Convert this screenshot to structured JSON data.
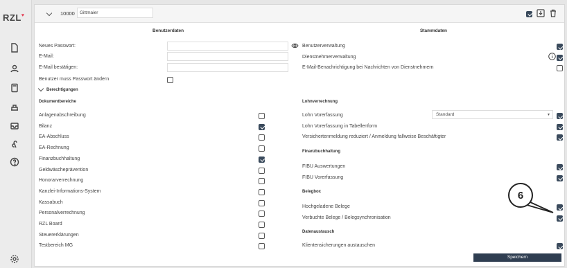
{
  "sidebar": {
    "logo": "RZL",
    "icons": [
      "document-icon",
      "users-icon",
      "calculator-icon",
      "stamp-icon",
      "inbox-icon",
      "clover-icon",
      "help-icon",
      "settings-icon"
    ]
  },
  "topbar": {
    "client_number": "10000",
    "client_name": "Gittmaier"
  },
  "left": {
    "heading": "Benutzerdaten",
    "fields": {
      "new_password": "Neues Passwort:",
      "email": "E-Mail:",
      "email_confirm": "E-Mail bestätigen:",
      "must_change": "Benutzer muss Passwort ändern"
    },
    "permissions_label": "Berechtigungen",
    "doc_areas_heading": "Dokumentbereiche",
    "doc_areas": [
      {
        "label": "Anlagenabschreibung",
        "checked": false
      },
      {
        "label": "Bilanz",
        "checked": true
      },
      {
        "label": "EA-Abschluss",
        "checked": false
      },
      {
        "label": "EA-Rechnung",
        "checked": false
      },
      {
        "label": "Finanzbuchhaltung",
        "checked": true
      },
      {
        "label": "Geldwäscheprävention",
        "checked": false
      },
      {
        "label": "Honorarverrechnung",
        "checked": false
      },
      {
        "label": "Kanzlei-Informations-System",
        "checked": false
      },
      {
        "label": "Kassabuch",
        "checked": false
      },
      {
        "label": "Personalverrechnung",
        "checked": false
      },
      {
        "label": "RZL Board",
        "checked": false
      },
      {
        "label": "Steuererklärungen",
        "checked": false
      },
      {
        "label": "Testbereich MG",
        "checked": false
      }
    ]
  },
  "right": {
    "heading": "Stammdaten",
    "master": [
      {
        "label": "Benutzerverwaltung",
        "checked": true
      },
      {
        "label": "Dienstnehmerverwaltung",
        "checked": true
      },
      {
        "label": "E-Mail-Benachrichtigung bei Nachrichten von Dienstnehmern",
        "checked": false
      }
    ],
    "payroll_heading": "Lohnverrechnung",
    "payroll": [
      {
        "label": "Lohn Vorerfassung",
        "checked": true
      },
      {
        "label": "Lohn Vorerfassung in Tabellenform",
        "checked": true
      },
      {
        "label": "Versichertenmeldung reduziert / Anmeldung fallweise Beschäftigter",
        "checked": true
      }
    ],
    "payroll_select": "Standard",
    "fibu_heading": "Finanzbuchhaltung",
    "fibu": [
      {
        "label": "FIBU Auswertungen",
        "checked": true
      },
      {
        "label": "FIBU Vorerfassung",
        "checked": true
      }
    ],
    "belegbox_heading": "Belegbox",
    "belegbox": [
      {
        "label": "Hochgeladene Belege",
        "checked": true
      },
      {
        "label": "Verbuchte Belege / Belegsynchronisation",
        "checked": true
      }
    ],
    "exchange_heading": "Datenaustausch",
    "exchange": [
      {
        "label": "Klientensicherungen austauschen",
        "checked": true
      }
    ]
  },
  "save_label": "Speichern",
  "callout_number": "6"
}
